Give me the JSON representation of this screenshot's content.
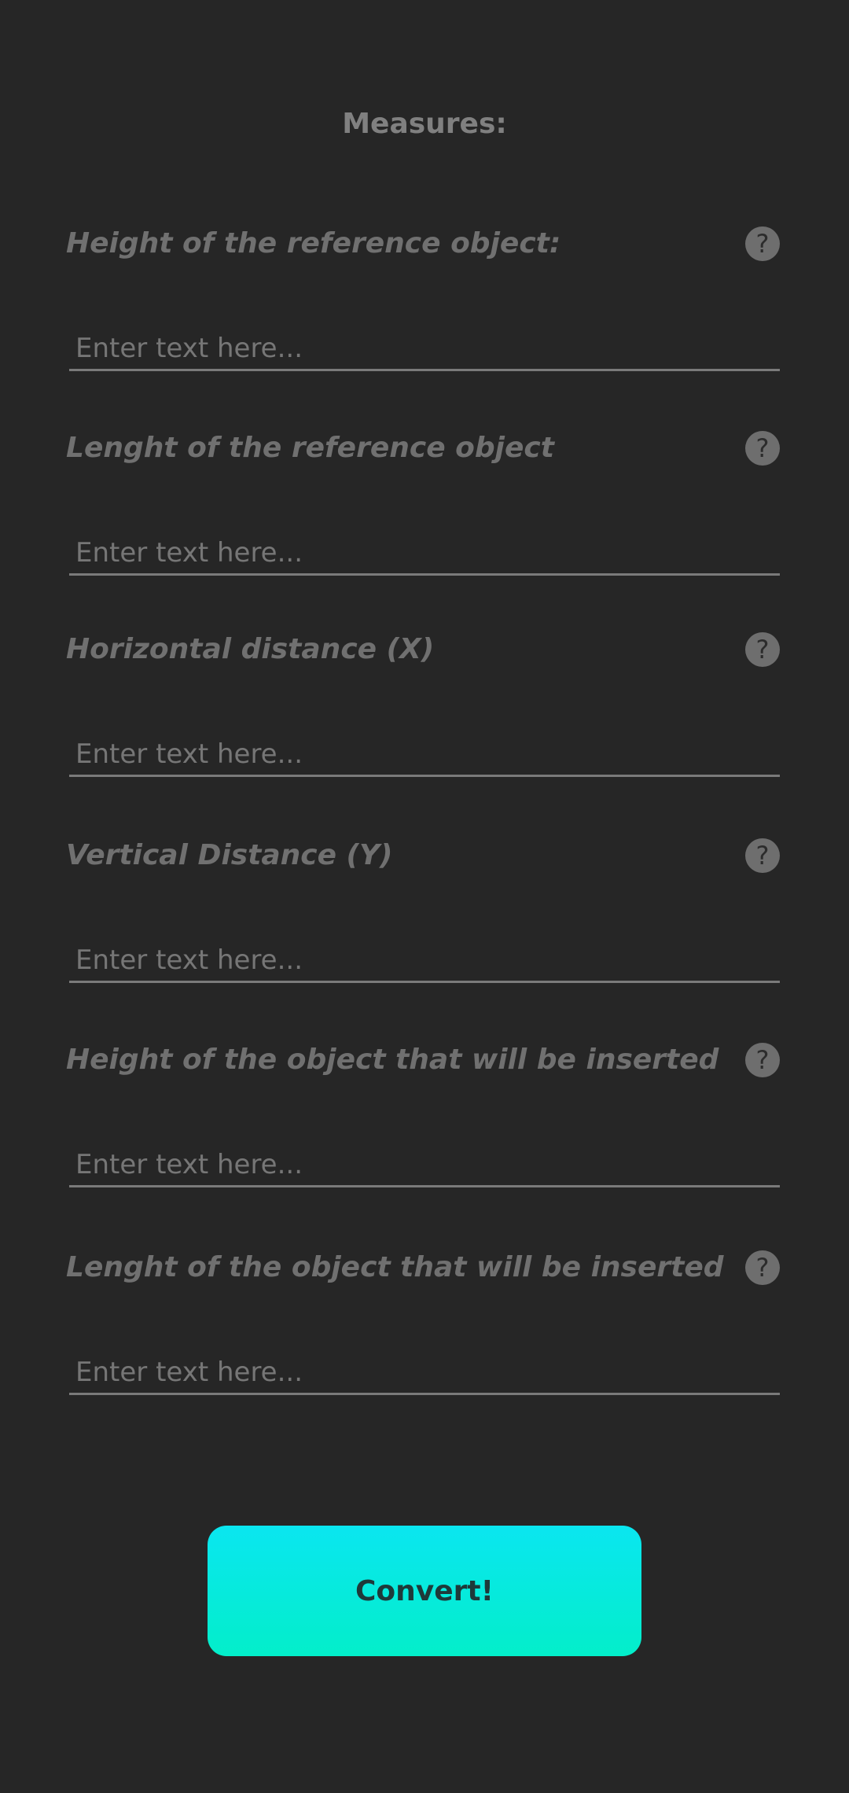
{
  "header": {
    "title": "Measures:"
  },
  "fields": [
    {
      "label": "Height of the reference object:",
      "placeholder": "Enter text here...",
      "help": "?"
    },
    {
      "label": "Lenght of the reference object",
      "placeholder": "Enter text here...",
      "help": "?"
    },
    {
      "label": "Horizontal distance (X)",
      "placeholder": "Enter text here...",
      "help": "?"
    },
    {
      "label": "Vertical Distance (Y)",
      "placeholder": "Enter text here...",
      "help": "?"
    },
    {
      "label": "Height of the object that will be inserted",
      "placeholder": "Enter text here...",
      "help": "?"
    },
    {
      "label": "Lenght of the object that will be inserted",
      "placeholder": "Enter text here...",
      "help": "?"
    }
  ],
  "actions": {
    "convert_label": "Convert!"
  },
  "colors": {
    "background": "#262626",
    "accent_top": "#0ae6f0",
    "accent_bottom": "#03eeca"
  }
}
